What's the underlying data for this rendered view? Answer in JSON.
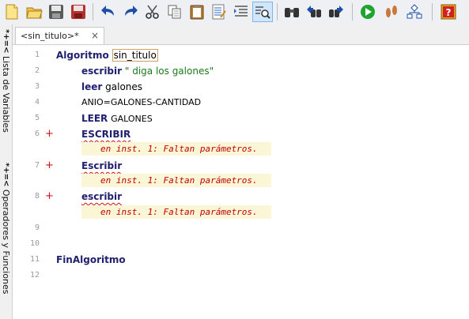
{
  "toolbar": {
    "buttons": [
      {
        "icon": "new-file-icon"
      },
      {
        "icon": "open-folder-icon"
      },
      {
        "icon": "save-icon"
      },
      {
        "icon": "save-as-icon"
      },
      {
        "icon": "undo-icon"
      },
      {
        "icon": "redo-icon"
      },
      {
        "icon": "cut-icon"
      },
      {
        "icon": "copy-icon"
      },
      {
        "icon": "paste-icon"
      },
      {
        "icon": "edit-list-icon"
      },
      {
        "icon": "indent-icon"
      },
      {
        "icon": "find-icon"
      },
      {
        "icon": "find-previous-icon"
      },
      {
        "icon": "find-next-icon"
      },
      {
        "icon": "run-icon"
      },
      {
        "icon": "step-icon"
      },
      {
        "icon": "flowchart-icon"
      },
      {
        "icon": "help-icon"
      }
    ]
  },
  "leftbar": {
    "variables_symbol": "*+=<",
    "variables_label": "Lista de Variables",
    "operators_symbol": "*+=<",
    "operators_label": "Operadores y Funciones"
  },
  "tab": {
    "title": "<sin_titulo>*",
    "close": "×"
  },
  "editor": {
    "line_numbers": [
      "1",
      "2",
      "3",
      "4",
      "5",
      "6",
      "7",
      "8",
      "9",
      "10",
      "11",
      "12"
    ],
    "error_marker": "+",
    "lines": {
      "l1_kw": "Algoritmo",
      "l1_name": "sin_titulo",
      "l2_kw": "escribir",
      "l2_str": "\" diga los galones\"",
      "l3_kw": "leer",
      "l3_rest": "galones",
      "l4": "ANIO=GALONES-CANTIDAD",
      "l5_kw": "LEER",
      "l5_rest": "GALONES",
      "l6_kw": "ESCRIBIR",
      "l7_kw": "Escribir",
      "l8_kw": "escribir",
      "l11_kw": "FinAlgoritmo"
    },
    "errors": [
      "en inst. 1: Faltan parámetros.",
      "en inst. 1: Faltan parámetros.",
      "en inst. 1: Faltan parámetros."
    ]
  }
}
